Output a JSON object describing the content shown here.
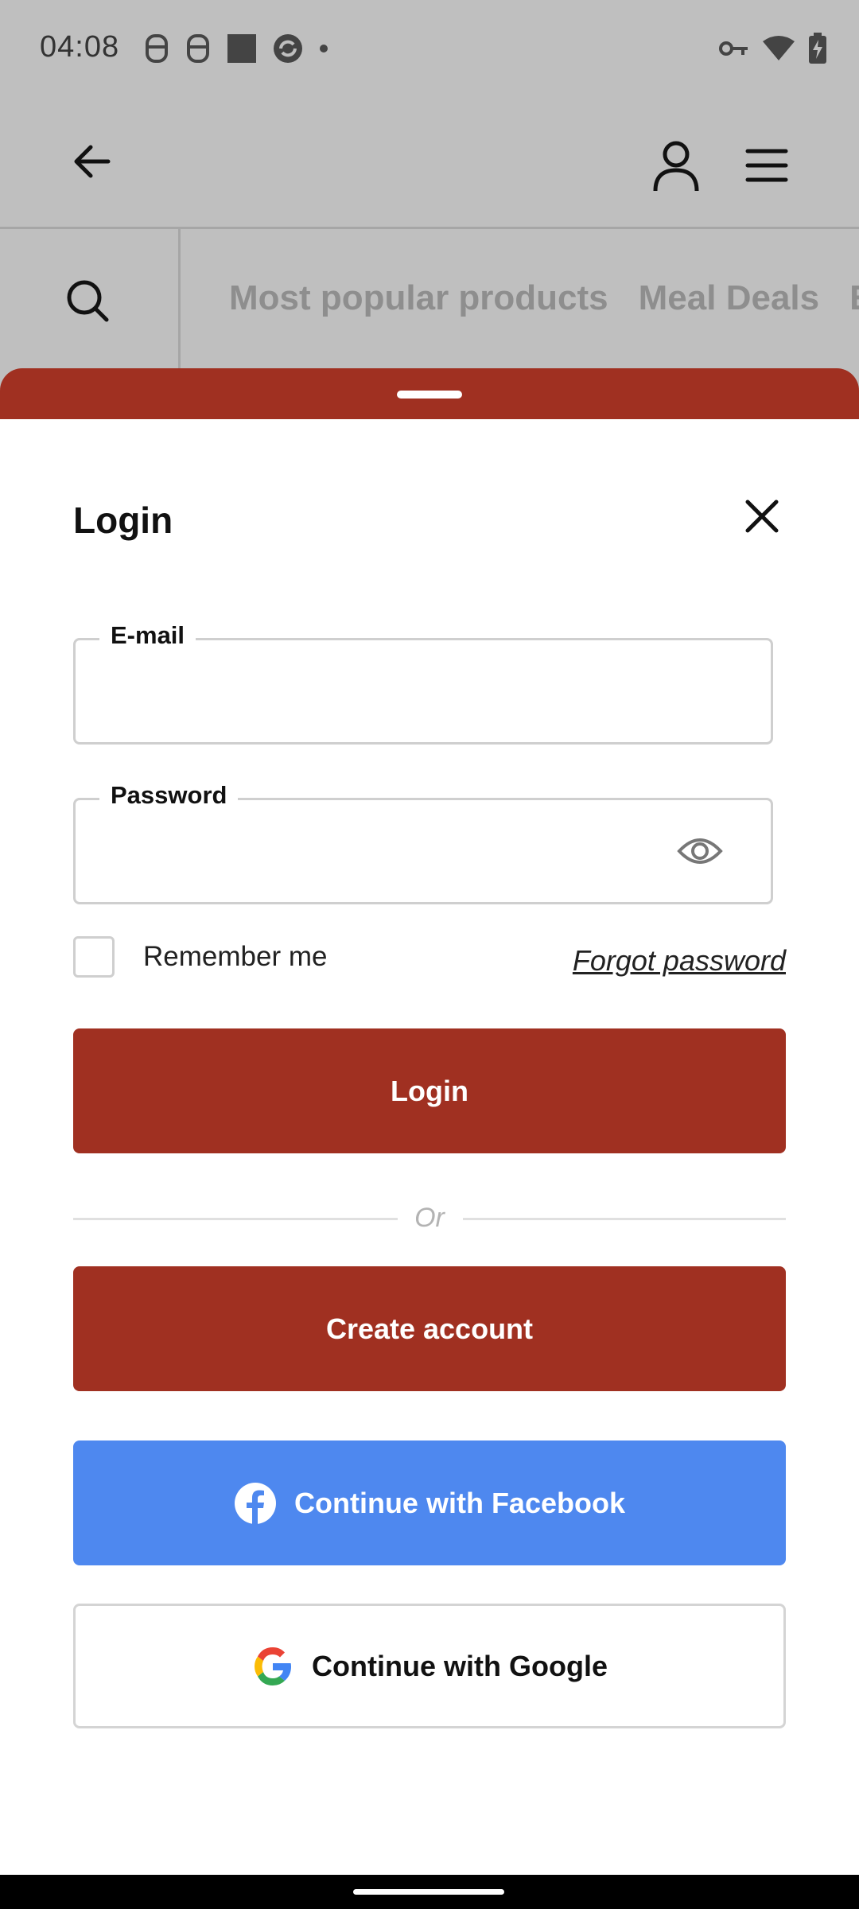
{
  "status_bar": {
    "time": "04:08",
    "left_icons": [
      "notification-icon",
      "notification-icon",
      "image-icon",
      "sync-icon",
      "dot-icon"
    ],
    "right_icons": [
      "vpn-key-icon",
      "wifi-icon",
      "battery-charging-icon"
    ]
  },
  "top_bar": {
    "back_icon": "arrow-left-icon",
    "account_icon": "user-icon",
    "menu_icon": "hamburger-menu-icon"
  },
  "categories": {
    "search_icon": "search-icon",
    "items": [
      "Most popular products",
      "Meal Deals",
      "E"
    ]
  },
  "login": {
    "title": "Login",
    "email_label": "E-mail",
    "email_value": "",
    "password_label": "Password",
    "password_value": "",
    "remember_label": "Remember me",
    "remember_checked": false,
    "forgot_label": "Forgot password",
    "login_button": "Login",
    "or_label": "Or",
    "create_account_button": "Create account",
    "facebook_button": "Continue with Facebook",
    "google_button": "Continue with Google"
  },
  "colors": {
    "accent": "#a03021",
    "facebook": "#4e88ef",
    "overlay": "#bfbfbf"
  }
}
